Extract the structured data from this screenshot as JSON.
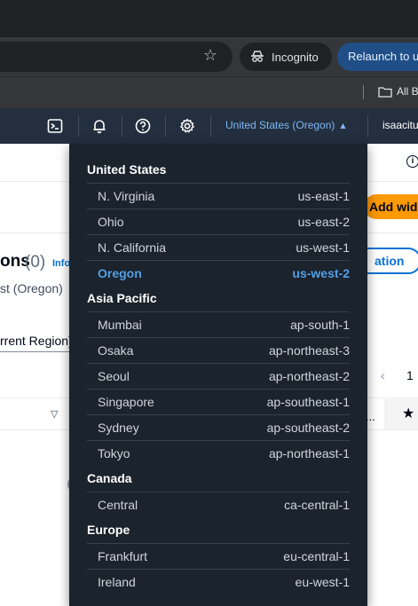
{
  "browser": {
    "incognito_label": "Incognito",
    "relaunch_label": "Relaunch to u",
    "bookmarks_folder_label": "All B"
  },
  "aws_nav": {
    "region_label": "United States (Oregon)",
    "account_label": "isaacitu"
  },
  "background": {
    "section_title": "ons",
    "section_count": "(0)",
    "info_link": "Info",
    "region_subtitle": "st (Oregon)",
    "filter_text": "rrent Region)",
    "add_widget_label": "Add wid",
    "create_button_label": "ation",
    "page_number": "1",
    "ellipsis": "..."
  },
  "region_menu": {
    "groups": [
      {
        "name": "United States",
        "regions": [
          {
            "name": "N. Virginia",
            "code": "us-east-1",
            "selected": false
          },
          {
            "name": "Ohio",
            "code": "us-east-2",
            "selected": false
          },
          {
            "name": "N. California",
            "code": "us-west-1",
            "selected": false
          },
          {
            "name": "Oregon",
            "code": "us-west-2",
            "selected": true
          }
        ]
      },
      {
        "name": "Asia Pacific",
        "regions": [
          {
            "name": "Mumbai",
            "code": "ap-south-1",
            "selected": false
          },
          {
            "name": "Osaka",
            "code": "ap-northeast-3",
            "selected": false
          },
          {
            "name": "Seoul",
            "code": "ap-northeast-2",
            "selected": false
          },
          {
            "name": "Singapore",
            "code": "ap-southeast-1",
            "selected": false
          },
          {
            "name": "Sydney",
            "code": "ap-southeast-2",
            "selected": false
          },
          {
            "name": "Tokyo",
            "code": "ap-northeast-1",
            "selected": false
          }
        ]
      },
      {
        "name": "Canada",
        "regions": [
          {
            "name": "Central",
            "code": "ca-central-1",
            "selected": false
          }
        ]
      },
      {
        "name": "Europe",
        "regions": [
          {
            "name": "Frankfurt",
            "code": "eu-central-1",
            "selected": false
          },
          {
            "name": "Ireland",
            "code": "eu-west-1",
            "selected": false
          }
        ]
      }
    ]
  },
  "colors": {
    "aws_nav_bg": "#232f3e",
    "dropdown_bg": "#1b232d",
    "region_link": "#7fb7f7",
    "selected_region": "#539fe5",
    "primary_orange": "#ff9900"
  },
  "icons": {
    "star": "bookmark-star-icon",
    "incognito": "incognito-icon",
    "folder": "folder-icon",
    "cloudshell": "cloudshell-icon",
    "notifications": "bell-icon",
    "help": "help-icon",
    "settings": "gear-icon",
    "region_caret": "caret-up-icon"
  }
}
